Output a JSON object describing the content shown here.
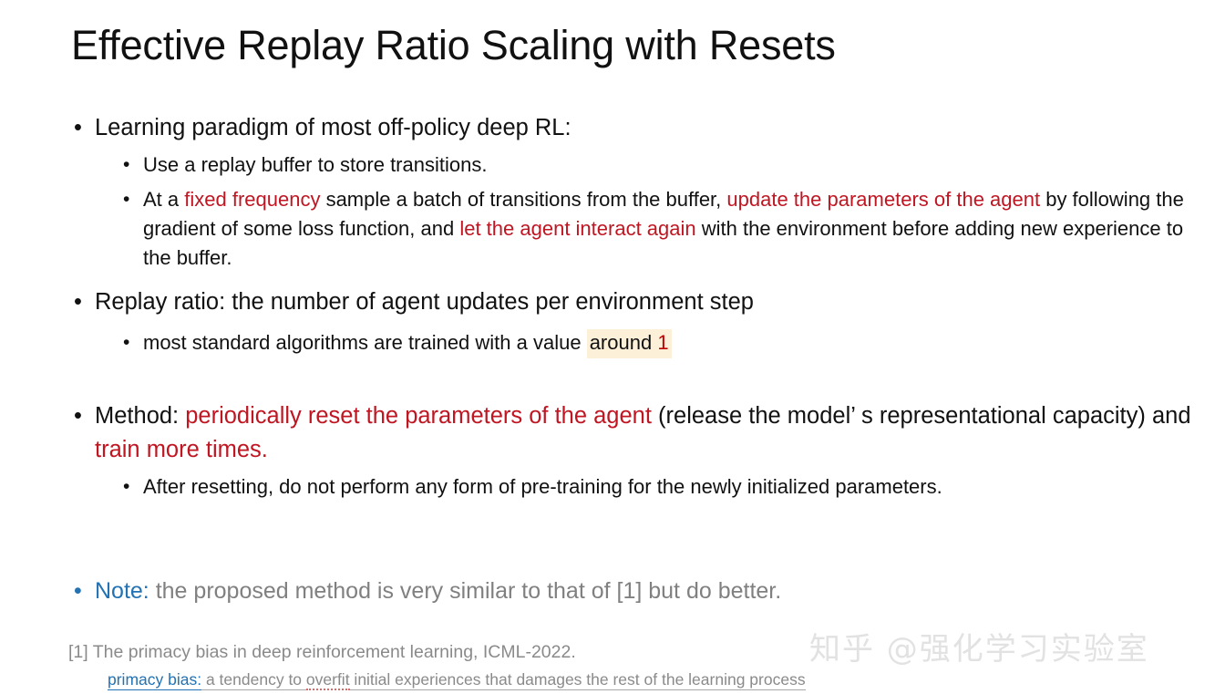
{
  "slide": {
    "title": "Effective Replay Ratio Scaling with Resets",
    "bullet_glyph": "•"
  },
  "colors": {
    "text": "#111111",
    "red_emphasis": "#bf1622",
    "highlight_bg": "#fcf0d9",
    "note_blue": "#2272b4",
    "muted_gray": "#8a8a8a",
    "watermark_gray": "#e2e2e2"
  },
  "content": {
    "b1_learning_paradigm": "Learning paradigm of most off-policy deep RL:",
    "b2_use_replay_buffer": "Use a replay buffer to store transitions.",
    "b2_fixed_frequency": {
      "seg1": "At a ",
      "red1": "fixed frequency",
      "seg2": " sample a batch of transitions from the buffer, ",
      "red2": "update the parameters of the agent",
      "seg3": " by following the gradient of some loss function, and ",
      "red3": "let the agent interact again",
      "seg4": " with the environment before adding new experience to the buffer."
    },
    "b1_replay_ratio": "Replay ratio: the number of agent updates per environment step",
    "b2_most_standard": {
      "seg1": "most standard algorithms are trained with a value ",
      "hl_text": "around ",
      "hl_value": "1"
    },
    "b1_method": {
      "seg1": "Method: ",
      "red1": "periodically reset the parameters of the agent",
      "seg2": " (release the model’  s representational capacity) and ",
      "red2": "train more times."
    },
    "b2_after_resetting": "After resetting, do not perform any form of pre-training for the newly initialized parameters.",
    "note": {
      "key": "Note:",
      "rest": " the proposed method is very similar to that of [1] but do better."
    }
  },
  "footnotes": {
    "ref_1": "[1] The primacy bias in deep reinforcement learning, ICML-2022.",
    "definition": {
      "term": "primacy bias:",
      "part1": " a tendency to ",
      "spell_word": "overfit",
      "part2": " initial experiences that damages the rest of the learning process"
    }
  },
  "watermark": {
    "text": "知乎 @强化学习实验室"
  }
}
